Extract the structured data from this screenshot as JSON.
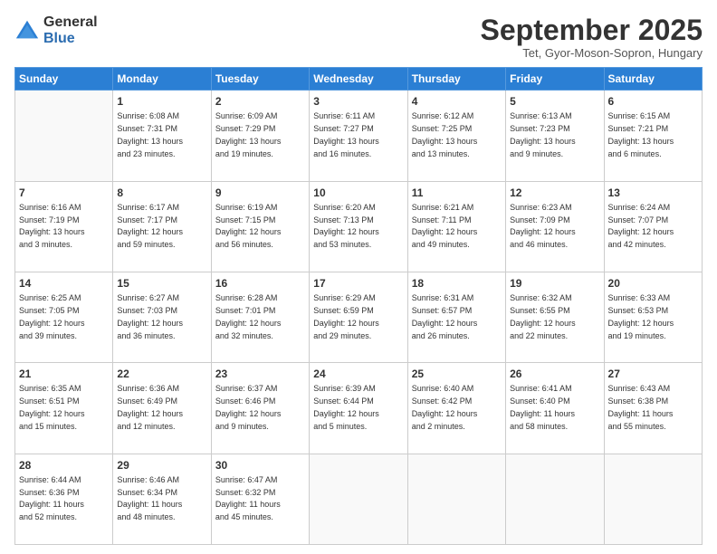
{
  "logo": {
    "general": "General",
    "blue": "Blue"
  },
  "header": {
    "month": "September 2025",
    "location": "Tet, Gyor-Moson-Sopron, Hungary"
  },
  "weekdays": [
    "Sunday",
    "Monday",
    "Tuesday",
    "Wednesday",
    "Thursday",
    "Friday",
    "Saturday"
  ],
  "weeks": [
    [
      {
        "day": "",
        "info": ""
      },
      {
        "day": "1",
        "info": "Sunrise: 6:08 AM\nSunset: 7:31 PM\nDaylight: 13 hours\nand 23 minutes."
      },
      {
        "day": "2",
        "info": "Sunrise: 6:09 AM\nSunset: 7:29 PM\nDaylight: 13 hours\nand 19 minutes."
      },
      {
        "day": "3",
        "info": "Sunrise: 6:11 AM\nSunset: 7:27 PM\nDaylight: 13 hours\nand 16 minutes."
      },
      {
        "day": "4",
        "info": "Sunrise: 6:12 AM\nSunset: 7:25 PM\nDaylight: 13 hours\nand 13 minutes."
      },
      {
        "day": "5",
        "info": "Sunrise: 6:13 AM\nSunset: 7:23 PM\nDaylight: 13 hours\nand 9 minutes."
      },
      {
        "day": "6",
        "info": "Sunrise: 6:15 AM\nSunset: 7:21 PM\nDaylight: 13 hours\nand 6 minutes."
      }
    ],
    [
      {
        "day": "7",
        "info": "Sunrise: 6:16 AM\nSunset: 7:19 PM\nDaylight: 13 hours\nand 3 minutes."
      },
      {
        "day": "8",
        "info": "Sunrise: 6:17 AM\nSunset: 7:17 PM\nDaylight: 12 hours\nand 59 minutes."
      },
      {
        "day": "9",
        "info": "Sunrise: 6:19 AM\nSunset: 7:15 PM\nDaylight: 12 hours\nand 56 minutes."
      },
      {
        "day": "10",
        "info": "Sunrise: 6:20 AM\nSunset: 7:13 PM\nDaylight: 12 hours\nand 53 minutes."
      },
      {
        "day": "11",
        "info": "Sunrise: 6:21 AM\nSunset: 7:11 PM\nDaylight: 12 hours\nand 49 minutes."
      },
      {
        "day": "12",
        "info": "Sunrise: 6:23 AM\nSunset: 7:09 PM\nDaylight: 12 hours\nand 46 minutes."
      },
      {
        "day": "13",
        "info": "Sunrise: 6:24 AM\nSunset: 7:07 PM\nDaylight: 12 hours\nand 42 minutes."
      }
    ],
    [
      {
        "day": "14",
        "info": "Sunrise: 6:25 AM\nSunset: 7:05 PM\nDaylight: 12 hours\nand 39 minutes."
      },
      {
        "day": "15",
        "info": "Sunrise: 6:27 AM\nSunset: 7:03 PM\nDaylight: 12 hours\nand 36 minutes."
      },
      {
        "day": "16",
        "info": "Sunrise: 6:28 AM\nSunset: 7:01 PM\nDaylight: 12 hours\nand 32 minutes."
      },
      {
        "day": "17",
        "info": "Sunrise: 6:29 AM\nSunset: 6:59 PM\nDaylight: 12 hours\nand 29 minutes."
      },
      {
        "day": "18",
        "info": "Sunrise: 6:31 AM\nSunset: 6:57 PM\nDaylight: 12 hours\nand 26 minutes."
      },
      {
        "day": "19",
        "info": "Sunrise: 6:32 AM\nSunset: 6:55 PM\nDaylight: 12 hours\nand 22 minutes."
      },
      {
        "day": "20",
        "info": "Sunrise: 6:33 AM\nSunset: 6:53 PM\nDaylight: 12 hours\nand 19 minutes."
      }
    ],
    [
      {
        "day": "21",
        "info": "Sunrise: 6:35 AM\nSunset: 6:51 PM\nDaylight: 12 hours\nand 15 minutes."
      },
      {
        "day": "22",
        "info": "Sunrise: 6:36 AM\nSunset: 6:49 PM\nDaylight: 12 hours\nand 12 minutes."
      },
      {
        "day": "23",
        "info": "Sunrise: 6:37 AM\nSunset: 6:46 PM\nDaylight: 12 hours\nand 9 minutes."
      },
      {
        "day": "24",
        "info": "Sunrise: 6:39 AM\nSunset: 6:44 PM\nDaylight: 12 hours\nand 5 minutes."
      },
      {
        "day": "25",
        "info": "Sunrise: 6:40 AM\nSunset: 6:42 PM\nDaylight: 12 hours\nand 2 minutes."
      },
      {
        "day": "26",
        "info": "Sunrise: 6:41 AM\nSunset: 6:40 PM\nDaylight: 11 hours\nand 58 minutes."
      },
      {
        "day": "27",
        "info": "Sunrise: 6:43 AM\nSunset: 6:38 PM\nDaylight: 11 hours\nand 55 minutes."
      }
    ],
    [
      {
        "day": "28",
        "info": "Sunrise: 6:44 AM\nSunset: 6:36 PM\nDaylight: 11 hours\nand 52 minutes."
      },
      {
        "day": "29",
        "info": "Sunrise: 6:46 AM\nSunset: 6:34 PM\nDaylight: 11 hours\nand 48 minutes."
      },
      {
        "day": "30",
        "info": "Sunrise: 6:47 AM\nSunset: 6:32 PM\nDaylight: 11 hours\nand 45 minutes."
      },
      {
        "day": "",
        "info": ""
      },
      {
        "day": "",
        "info": ""
      },
      {
        "day": "",
        "info": ""
      },
      {
        "day": "",
        "info": ""
      }
    ]
  ]
}
